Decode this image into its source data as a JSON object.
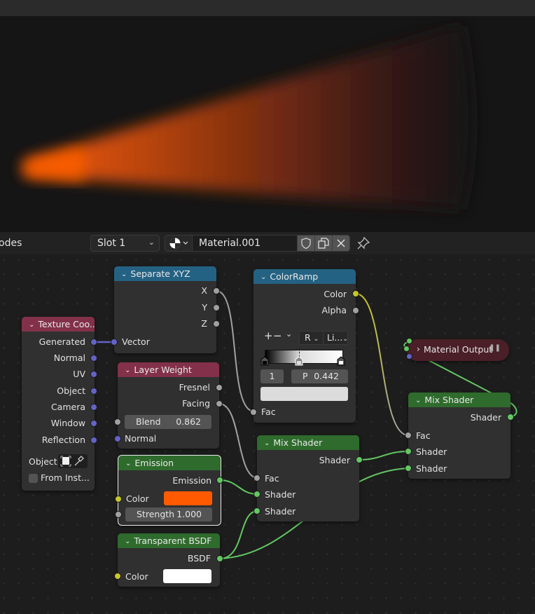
{
  "header": {
    "editor_label": "odes",
    "slot": "Slot 1",
    "material_name": "Material.001",
    "icons": [
      "shader-ball-icon",
      "fake-user-shield-icon",
      "duplicate-icon",
      "close-icon",
      "pin-icon"
    ]
  },
  "viewport": {
    "render": "orange volumetric cone",
    "emission_color": "#ff5a00"
  },
  "nodes": {
    "texture_coord": {
      "title": "Texture Coo...",
      "outputs": [
        "Generated",
        "Normal",
        "UV",
        "Object",
        "Camera",
        "Window",
        "Reflection"
      ],
      "object_label": "Object:",
      "from_instancer": "From Inst..."
    },
    "separate_xyz": {
      "title": "Separate XYZ",
      "outputs": [
        "X",
        "Y",
        "Z"
      ],
      "inputs": [
        "Vector"
      ]
    },
    "layer_weight": {
      "title": "Layer Weight",
      "outputs": [
        "Fresnel",
        "Facing"
      ],
      "blend_label": "Blend",
      "blend_value": "0.862",
      "inputs": [
        "Normal"
      ]
    },
    "emission": {
      "title": "Emission",
      "output": "Emission",
      "color_label": "Color",
      "color": "#ff5a00",
      "strength_label": "Strength",
      "strength_value": "1.000"
    },
    "transparent_bsdf": {
      "title": "Transparent BSDF",
      "output": "BSDF",
      "color_label": "Color",
      "color": "#ffffff"
    },
    "color_ramp": {
      "title": "ColorRamp",
      "outputs": [
        "Color",
        "Alpha"
      ],
      "add": "+",
      "remove": "−",
      "color_mode": "R",
      "interpolation": "Li...",
      "active_index": "1",
      "pos_label": "P",
      "pos_value": "0.442",
      "stops": [
        0.0,
        0.442,
        1.0
      ],
      "active_color": "#dcdcdc",
      "input": "Fac"
    },
    "mix_shader_1": {
      "title": "Mix Shader",
      "output": "Shader",
      "inputs": [
        "Fac",
        "Shader",
        "Shader"
      ]
    },
    "mix_shader_2": {
      "title": "Mix Shader",
      "output": "Shader",
      "inputs": [
        "Fac",
        "Shader",
        "Shader"
      ]
    },
    "material_output": {
      "title": "Material Output"
    }
  }
}
